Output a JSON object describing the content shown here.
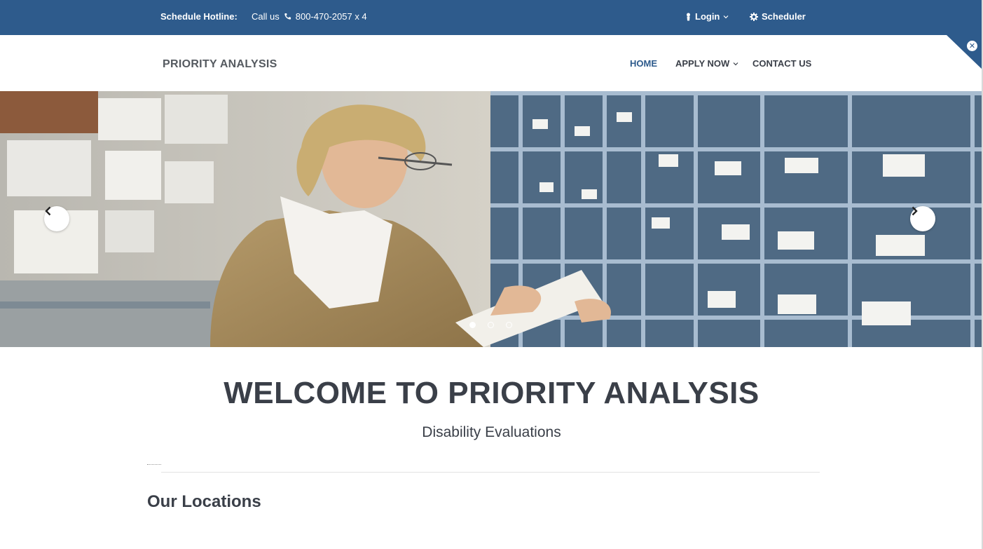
{
  "colors": {
    "topbar": "#2e5b8c",
    "text": "#3a3f48",
    "accent": "#2e5b8c"
  },
  "topbar": {
    "hotline_label": "Schedule Hotline:",
    "call_label": "Call us",
    "phone": "800-470-2057 x 4",
    "login": "Login",
    "scheduler": "Scheduler"
  },
  "header": {
    "logo": "PRIORITY ANALYSIS",
    "nav": {
      "home": "HOME",
      "apply": "APPLY NOW",
      "contact": "CONTACT US"
    }
  },
  "hero": {
    "slides_total": 3,
    "active_slide": 1,
    "icons": [
      "chevron-left-icon",
      "chevron-right-icon"
    ]
  },
  "main": {
    "title": "WELCOME TO PRIORITY ANALYSIS",
    "subtitle": "Disability Evaluations",
    "section_bold": "Our",
    "section_rest": "Locations"
  }
}
